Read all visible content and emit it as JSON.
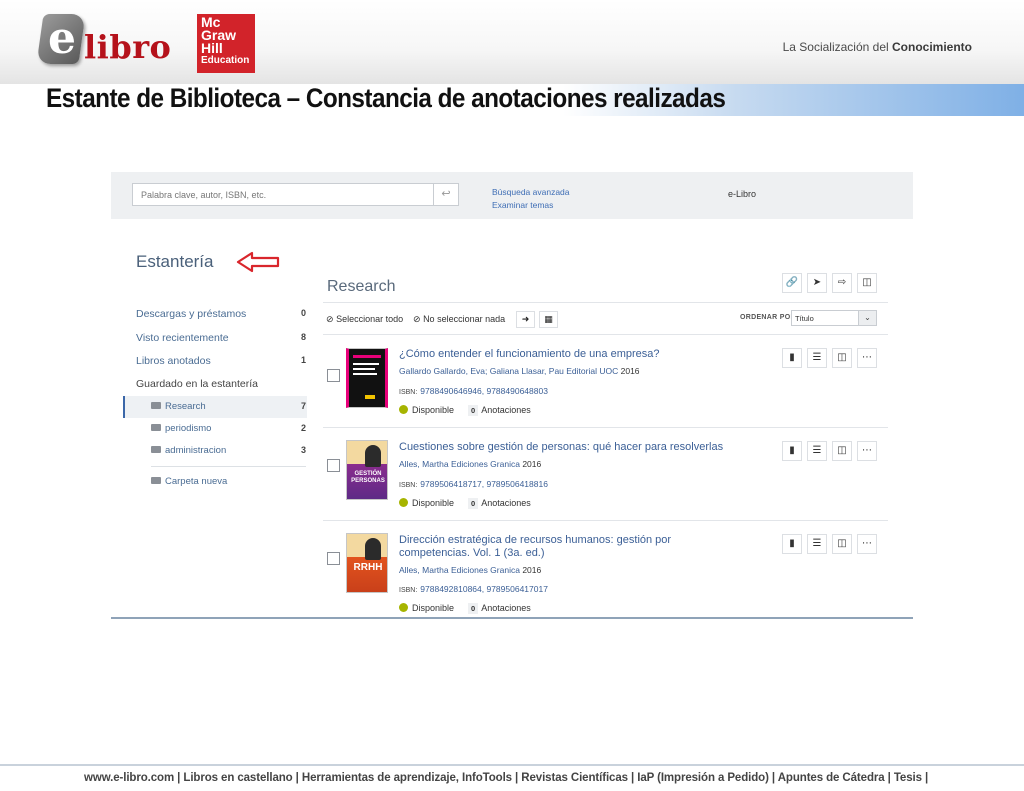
{
  "header": {
    "logo_e": "e",
    "logo_libro": "libro",
    "mcgraw_lines": [
      "Mc",
      "Graw",
      "Hill",
      "Education"
    ],
    "tagline_prefix": "La Socialización del ",
    "tagline_bold": "Conocimiento",
    "title": "Estante de Biblioteca – Constancia de anotaciones realizadas"
  },
  "search": {
    "placeholder": "Palabra clave, autor, ISBN, etc.",
    "go_icon": "↩",
    "advanced": "Búsqueda avanzada",
    "browse": "Examinar temas",
    "brand": "e-Libro"
  },
  "sidebar": {
    "heading": "Estantería",
    "items": [
      {
        "label": "Descargas y préstamos",
        "count": "0"
      },
      {
        "label": "Visto recientemente",
        "count": "8"
      },
      {
        "label": "Libros anotados",
        "count": "1"
      }
    ],
    "saved_label": "Guardado en la estantería",
    "folders": [
      {
        "label": "Research",
        "count": "7"
      },
      {
        "label": "periodismo",
        "count": "2"
      },
      {
        "label": "administracion",
        "count": "3"
      }
    ],
    "new_folder": "Carpeta nueva"
  },
  "list": {
    "title": "Research",
    "select_all": "Seleccionar todo",
    "select_none": "No seleccionar nada",
    "sort_label": "ORDENAR POR",
    "sort_value": "Título",
    "action_icons": [
      "link-icon",
      "send-icon",
      "export-icon",
      "comment-icon"
    ],
    "books": [
      {
        "title": "¿Cómo entender el funcionamiento de una empresa?",
        "authors": "Gallardo Gallardo, Eva; Galiana Llasar, Pau  Editorial UOC",
        "year": "2016",
        "isbn_label": "ISBN:",
        "isbn": "9788490646946, 9788490648803",
        "status": "Disponible",
        "annotations_count": "0",
        "annotations_label": "Anotaciones",
        "cover_color": "#1a1a1a"
      },
      {
        "title": "Cuestiones sobre gestión de personas: qué hacer para resolverlas",
        "authors": "Alles, Martha  Ediciones Granica",
        "year": "2016",
        "isbn_label": "ISBN:",
        "isbn": "9789506418717, 9789506418816",
        "status": "Disponible",
        "annotations_count": "0",
        "annotations_label": "Anotaciones",
        "cover_text": "GESTIÓN PERSONAS",
        "cover_color": "#7a2a86"
      },
      {
        "title": "Dirección estratégica de recursos humanos: gestión por competencias. Vol. 1 (3a. ed.)",
        "authors": "Alles, Martha  Ediciones Granica",
        "year": "2016",
        "isbn_label": "ISBN:",
        "isbn": "9788492810864, 9789506417017",
        "status": "Disponible",
        "annotations_count": "0",
        "annotations_label": "Anotaciones",
        "cover_text": "RRHH",
        "cover_color": "#e2531e"
      }
    ]
  },
  "footer": {
    "text": "www.e-libro.com | Libros en castellano | Herramientas de aprendizaje, InfoTools | Revistas Científicas | IaP (Impresión a Pedido) | Apuntes de Cátedra | Tesis |"
  },
  "colors": {
    "brand_red": "#b5121b",
    "mcgraw_red": "#d2232a",
    "link_blue": "#3b5f96",
    "available_green": "#a6b400",
    "annotation_arrow": "#d9262c"
  }
}
